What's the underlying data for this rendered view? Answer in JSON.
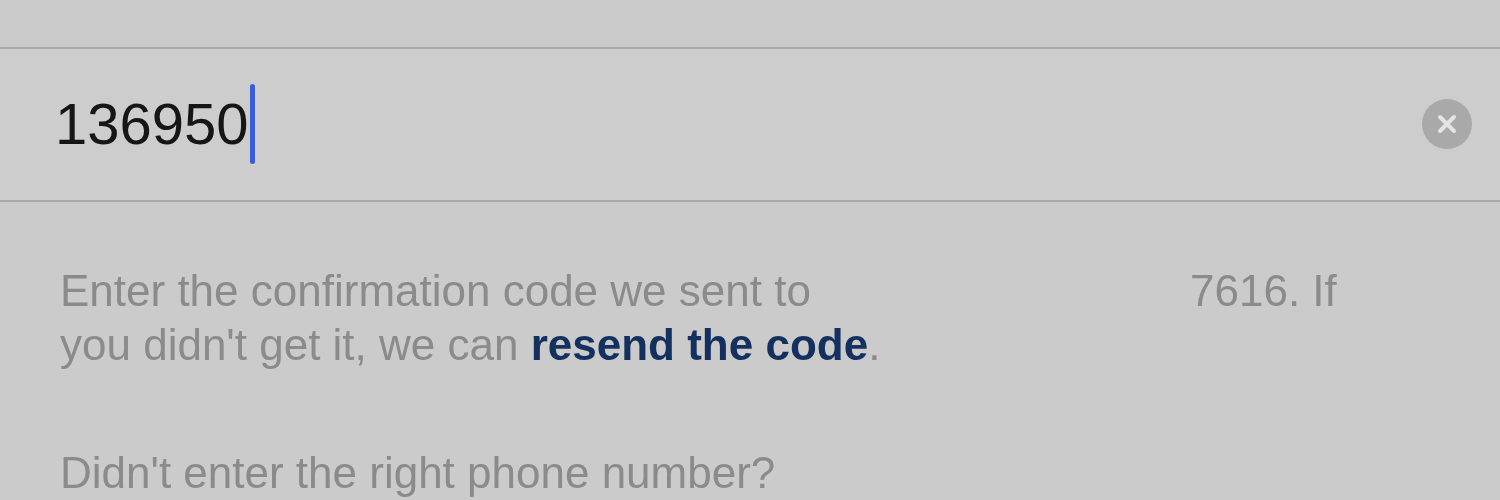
{
  "code_field": {
    "value": "136950",
    "focused": true
  },
  "message": {
    "line_1_start": "Enter the confirmation code we sent to",
    "line_1_end": "7616. If",
    "line_2_start": "you didn't get it, we can",
    "link": "resend the code",
    "line_2_end": "."
  },
  "wrong_number_prompt": "Didn't enter the right phone number?"
}
